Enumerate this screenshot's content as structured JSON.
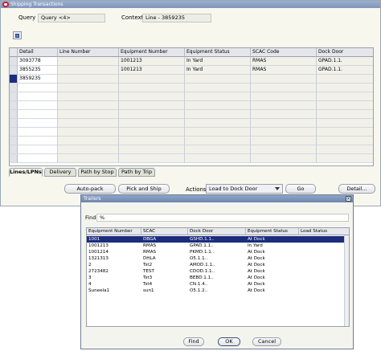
{
  "window": {
    "title": "Shipping Transactions"
  },
  "query": {
    "label": "Query",
    "value": "Query <4>"
  },
  "context": {
    "label": "Context",
    "value": "Line - 3859235"
  },
  "grid": {
    "columns": [
      "Detail",
      "Line Number",
      "Equipment Number",
      "Equipment Status",
      "SCAC Code",
      "Dock Door"
    ],
    "rows": [
      [
        "3093778",
        "",
        "1001213",
        "In Yard",
        "RMAS",
        "GPAD.1.1."
      ],
      [
        "3855235",
        "",
        "1001213",
        "In Yard",
        "RMAS",
        "GPAD.1.1."
      ],
      [
        "3859235",
        "",
        "",
        "",
        "",
        ""
      ]
    ]
  },
  "tabs": [
    "Lines/LPNs",
    "Delivery",
    "Path by Stop",
    "Path by Trip"
  ],
  "actions": {
    "autopack": "Auto-pack",
    "pick_ship": "Pick and Ship",
    "actions_label": "Actions",
    "actions_value": "Load to Dock Door",
    "go": "Go",
    "detail": "Detail..."
  },
  "dialog": {
    "title": "Trailers",
    "find_label": "Find",
    "find_value": "%",
    "columns": [
      "Equipment Number",
      "SCAC",
      "Dock Door",
      "Equipment Status",
      "Load Status"
    ],
    "rows": [
      [
        "1001",
        "DBGA",
        "GSHD.1.1..",
        "At Dock",
        ""
      ],
      [
        "1001213",
        "RMAS",
        "GPAD.1.1..",
        "In Yard",
        ""
      ],
      [
        "1001214",
        "RMAS",
        "PKMD.1.1..",
        "At Dock",
        ""
      ],
      [
        "1321313",
        "DHLA",
        "O5.1.1..",
        "At Dock",
        ""
      ],
      [
        "2",
        "Tst2",
        "AMOD.1.1..",
        "At Dock",
        ""
      ],
      [
        "2723482",
        "TEST",
        "CDOD.1.1..",
        "At Dock",
        ""
      ],
      [
        "3",
        "Tst3",
        "BEBD.1.1..",
        "At Dock",
        ""
      ],
      [
        "4",
        "Tst4",
        "CN.1.4..",
        "At Dock",
        ""
      ],
      [
        "Suneela1",
        "sun1",
        "O5.1.2..",
        "At Dock",
        ""
      ]
    ],
    "buttons": {
      "find": "Find",
      "ok": "OK",
      "cancel": "Cancel"
    }
  },
  "colors": {
    "selection": "#1c2d7c",
    "titlebar": "#7f95b8",
    "window_bg": "#f7f7ee"
  }
}
